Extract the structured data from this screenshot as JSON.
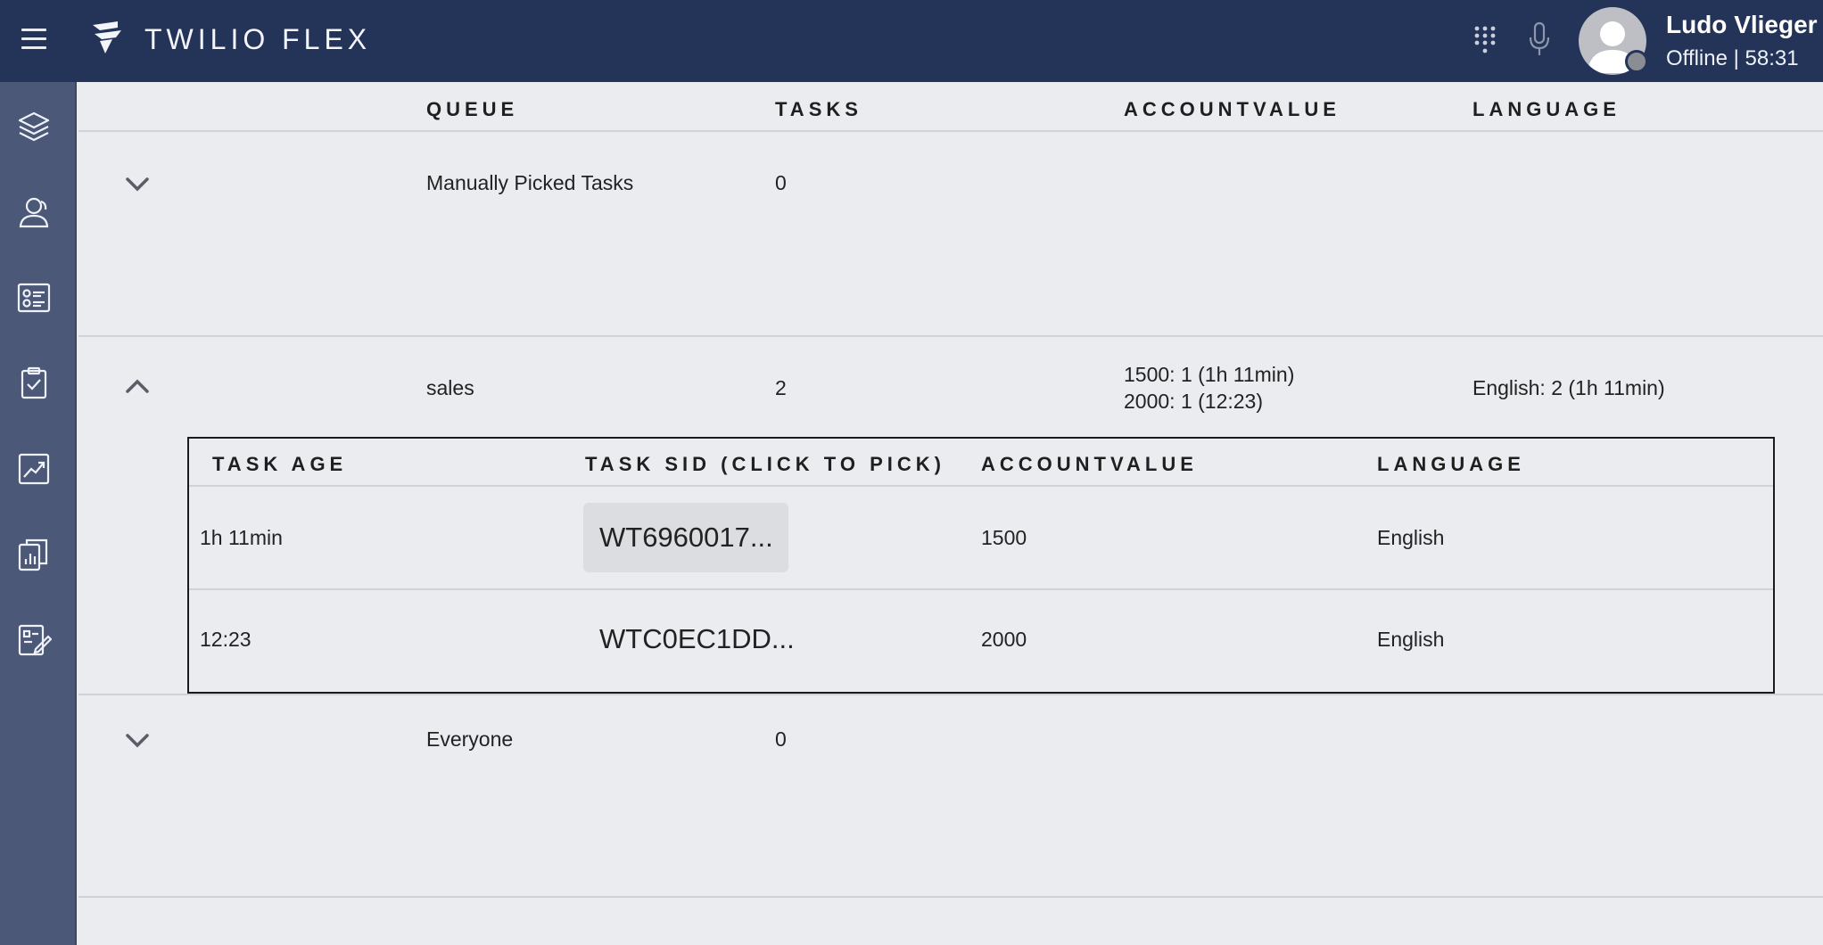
{
  "app": {
    "brand": "TWILIO FLEX"
  },
  "user": {
    "name": "Ludo Vlieger",
    "status": "Offline | 58:31"
  },
  "colors": {
    "topbar": "#243358",
    "sidebar": "#4b5877",
    "background": "#ebecf0"
  },
  "sidebar": {
    "items": [
      {
        "icon": "layers-icon"
      },
      {
        "icon": "agents-icon"
      },
      {
        "icon": "contact-card-icon"
      },
      {
        "icon": "clipboard-check-icon"
      },
      {
        "icon": "trend-chart-icon"
      },
      {
        "icon": "reports-icon"
      },
      {
        "icon": "edit-form-icon"
      }
    ]
  },
  "queues_table": {
    "headers": {
      "queue": "QUEUE",
      "tasks": "TASKS",
      "accountvalue": "ACCOUNTVALUE",
      "language": "LANGUAGE"
    },
    "rows": [
      {
        "queue": "Manually Picked Tasks",
        "tasks": "0",
        "accountvalue": "",
        "accountvalue2": "",
        "language": "",
        "expanded": false
      },
      {
        "queue": "sales",
        "tasks": "2",
        "accountvalue": "1500: 1 (1h 11min)",
        "accountvalue2": "2000: 1 (12:23)",
        "language": "English: 2 (1h 11min)",
        "expanded": true
      },
      {
        "queue": "Everyone",
        "tasks": "0",
        "accountvalue": "",
        "accountvalue2": "",
        "language": "",
        "expanded": false
      }
    ]
  },
  "tasks_table": {
    "headers": {
      "age": "TASK AGE",
      "sid": "TASK SID (CLICK TO PICK)",
      "accountvalue": "ACCOUNTVALUE",
      "language": "LANGUAGE"
    },
    "rows": [
      {
        "age": "1h 11min",
        "sid": "WT6960017...",
        "accountvalue": "1500",
        "language": "English"
      },
      {
        "age": "12:23",
        "sid": "WTC0EC1DD...",
        "accountvalue": "2000",
        "language": "English"
      }
    ]
  }
}
